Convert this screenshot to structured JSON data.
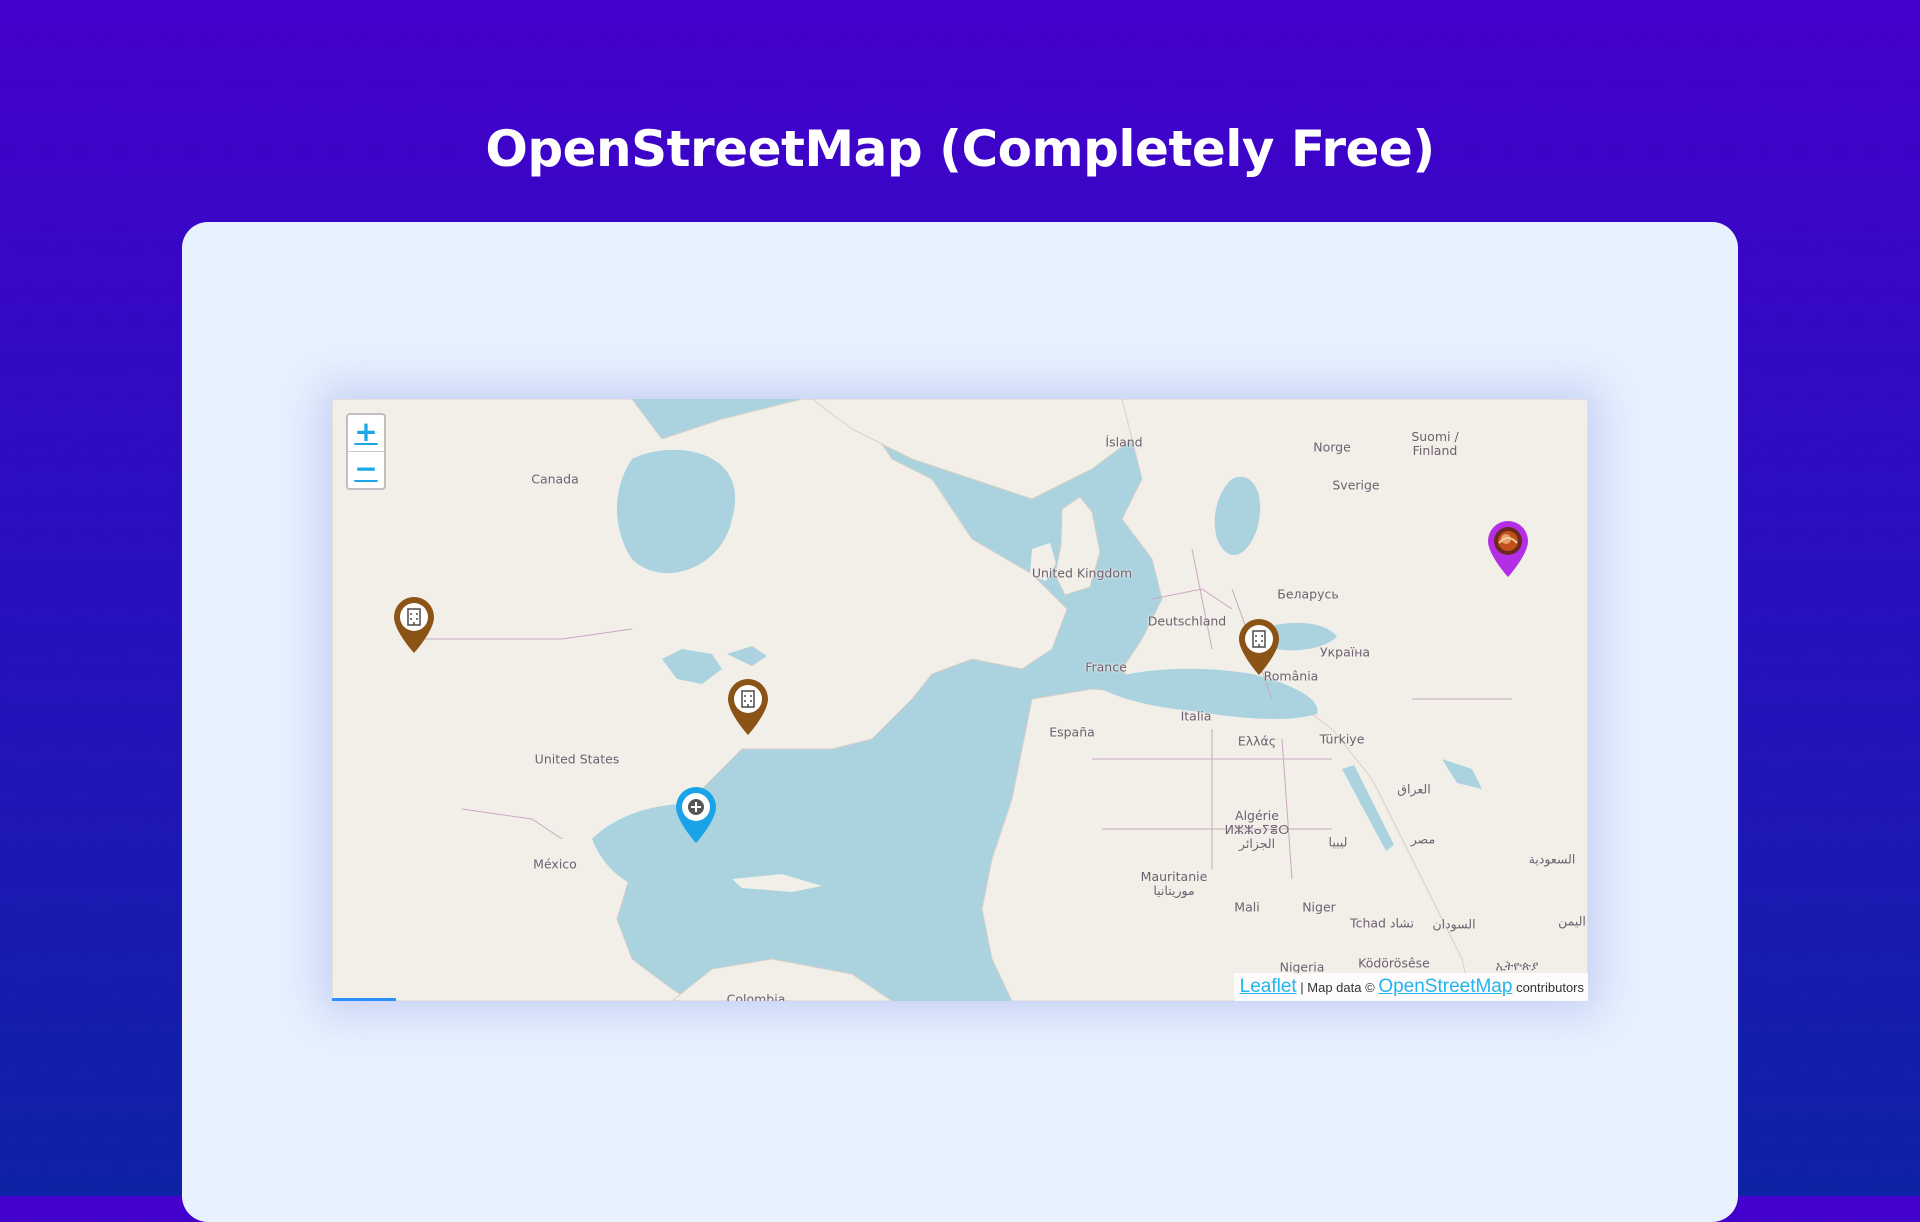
{
  "page": {
    "title": "OpenStreetMap (Completely Free)"
  },
  "map": {
    "zoom_in_label": "+",
    "zoom_out_label": "−",
    "labels": [
      {
        "key": "island",
        "text": "Ísland"
      },
      {
        "key": "canada",
        "text": "Canada"
      },
      {
        "key": "norge",
        "text": "Norge"
      },
      {
        "key": "suomi",
        "text": "Suomi /\nFinland"
      },
      {
        "key": "sverige",
        "text": "Sverige"
      },
      {
        "key": "uk",
        "text": "United Kingdom"
      },
      {
        "key": "deutschland",
        "text": "Deutschland"
      },
      {
        "key": "belarus",
        "text": "Беларусь"
      },
      {
        "key": "ukraina",
        "text": "Україна"
      },
      {
        "key": "france",
        "text": "France"
      },
      {
        "key": "romania",
        "text": "România"
      },
      {
        "key": "italia",
        "text": "Italia"
      },
      {
        "key": "espana",
        "text": "España"
      },
      {
        "key": "ellas",
        "text": "Ελλάς"
      },
      {
        "key": "turkiye",
        "text": "Türkiye"
      },
      {
        "key": "iraq",
        "text": "العراق"
      },
      {
        "key": "us",
        "text": "United States"
      },
      {
        "key": "algerie",
        "text": "Algérie\nⵍⵣⵣⴰⵢⴻⵔ\nالجزائر"
      },
      {
        "key": "libya",
        "text": "ليبيا"
      },
      {
        "key": "misr",
        "text": "مصر"
      },
      {
        "key": "saudi",
        "text": "السعودية"
      },
      {
        "key": "mexico",
        "text": "México"
      },
      {
        "key": "mauritanie",
        "text": "Mauritanie\nموريتانيا"
      },
      {
        "key": "mali",
        "text": "Mali"
      },
      {
        "key": "niger",
        "text": "Niger"
      },
      {
        "key": "tchad",
        "text": "Tchad تشاد"
      },
      {
        "key": "sudan",
        "text": "السودان"
      },
      {
        "key": "yemen",
        "text": "اليمن"
      },
      {
        "key": "nigeria",
        "text": "Nigeria"
      },
      {
        "key": "kodorosese",
        "text": "Ködörösêse"
      },
      {
        "key": "ethiopia",
        "text": "ኢትዮጵያ"
      },
      {
        "key": "colombia",
        "text": "Colombia"
      }
    ],
    "markers": [
      {
        "key": "seattle",
        "type": "office",
        "color": "#8b5316",
        "icon": "building-icon"
      },
      {
        "key": "newyork",
        "type": "office",
        "color": "#8b5316",
        "icon": "building-icon"
      },
      {
        "key": "paris",
        "type": "office",
        "color": "#8b5316",
        "icon": "building-icon"
      },
      {
        "key": "florida",
        "type": "medical",
        "color": "#1aa3e8",
        "icon": "plus-circle-icon"
      },
      {
        "key": "moscow",
        "type": "avatar",
        "color": "#b42ee6",
        "icon": "avatar-icon"
      }
    ],
    "attribution": {
      "leaflet": "Leaflet",
      "separator": "| Map data ©",
      "osm": "OpenStreetMap",
      "suffix": "contributors"
    },
    "colors": {
      "water": "#aad3df",
      "land": "#f2efe9",
      "border": "#c8a8c0"
    }
  }
}
